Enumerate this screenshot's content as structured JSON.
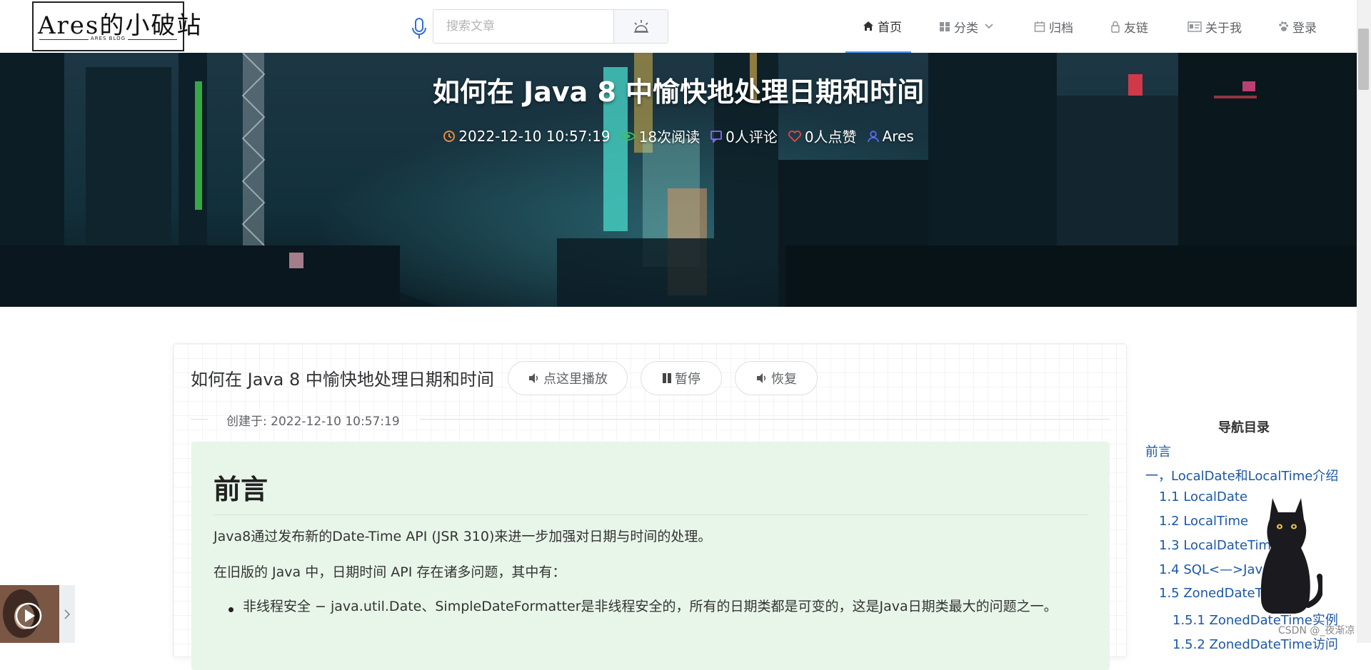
{
  "header": {
    "logo_main": "Ares的小破站",
    "logo_sub": "ARES BLOG",
    "search_placeholder": "搜索文章",
    "nav": [
      {
        "label": "首页",
        "icon": "home-icon"
      },
      {
        "label": "分类",
        "icon": "grid-icon"
      },
      {
        "label": "归档",
        "icon": "calendar-icon"
      },
      {
        "label": "友链",
        "icon": "lock-icon"
      },
      {
        "label": "关于我",
        "icon": "id-card-icon"
      },
      {
        "label": "登录",
        "icon": "paw-icon"
      }
    ]
  },
  "banner": {
    "title": "如何在 Java 8 中愉快地处理日期和时间",
    "datetime": "2022-12-10 10:57:19",
    "reads": "18次阅读",
    "comments": "0人评论",
    "likes": "0人点赞",
    "author": "Ares"
  },
  "article": {
    "title": "如何在 Java 8 中愉快地处理日期和时间",
    "play_label": "点这里播放",
    "pause_label": "暂停",
    "resume_label": "恢复",
    "created": "创建于: 2022-12-10 10:57:19",
    "heading": "前言",
    "para1": "Java8通过发布新的Date-Time API (JSR 310)来进一步加强对日期与时间的处理。",
    "para2": "在旧版的 Java 中，日期时间 API 存在诸多问题，其中有：",
    "bullet1": "非线程安全 − java.util.Date、SimpleDateFormatter是非线程安全的，所有的日期类都是可变的，这是Java日期类最大的问题之一。"
  },
  "toc": {
    "title": "导航目录",
    "items": [
      "前言",
      "一，LocalDate和LocalTime介绍",
      "1.1 LocalDate",
      "1.2 LocalTime",
      "1.3 LocalDateTime",
      "1.4 SQL<—>Java",
      "1.5 ZonedDateTime",
      "1.5.1 ZonedDateTime实例",
      "1.5.2 ZonedDateTime访问"
    ]
  },
  "watermark": "CSDN @_夜渐凉"
}
